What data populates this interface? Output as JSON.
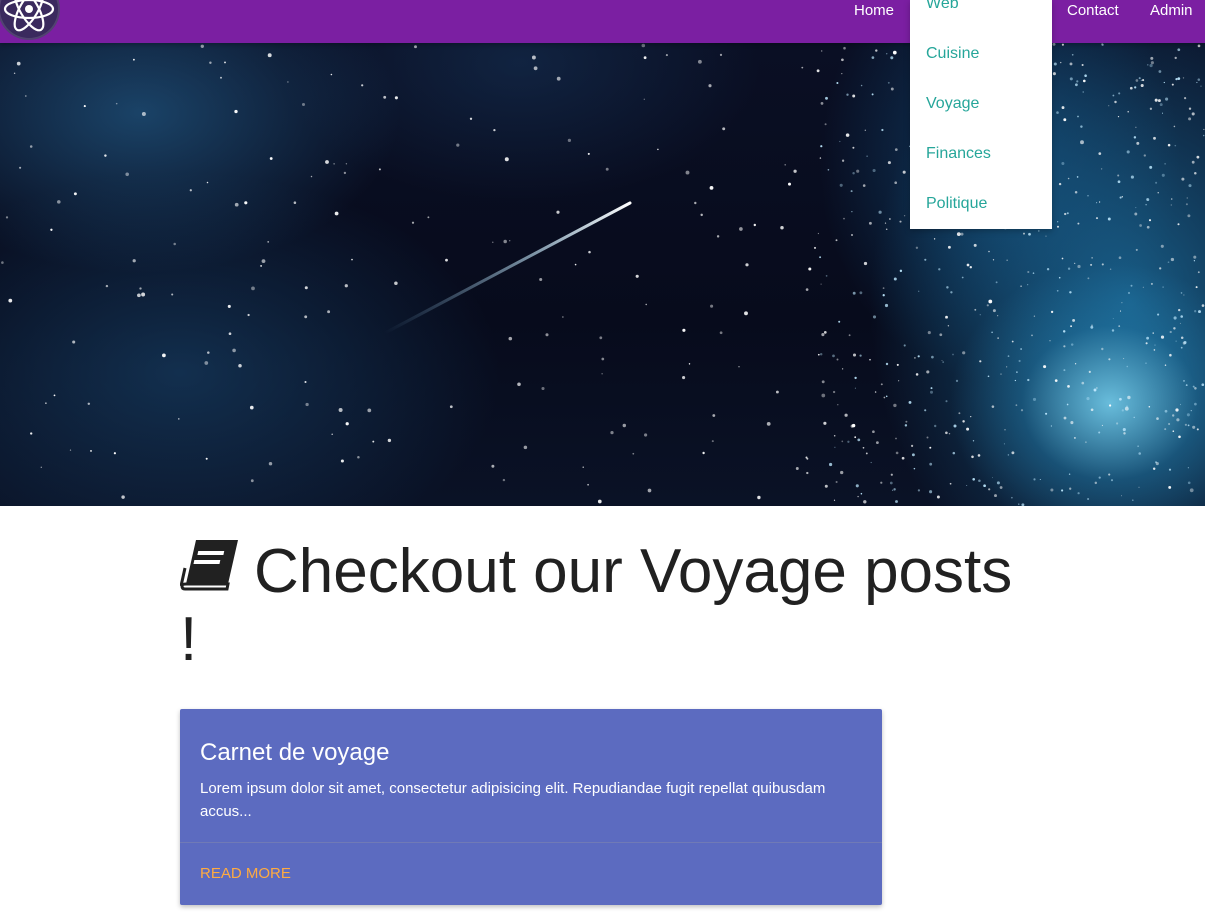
{
  "navbar": {
    "logo": "atom-icon",
    "links": [
      "Home",
      "Contact",
      "Admin"
    ],
    "background_color": "#7b1fa2"
  },
  "dropdown": {
    "items": [
      "Web",
      "Cuisine",
      "Voyage",
      "Finances",
      "Politique"
    ],
    "item_color": "#26a69a"
  },
  "hero": {
    "image": "starry-night-sky-with-shooting-star"
  },
  "main": {
    "heading_icon": "book-icon",
    "heading": "Checkout our Voyage posts !"
  },
  "posts": [
    {
      "title": "Carnet de voyage",
      "excerpt": "Lorem ipsum dolor sit amet, consectetur adipisicing elit. Repudiandae fugit repellat quibusdam accus...",
      "action": "READ MORE",
      "card_color": "#5c6bc0",
      "action_color": "#ffab40"
    }
  ]
}
